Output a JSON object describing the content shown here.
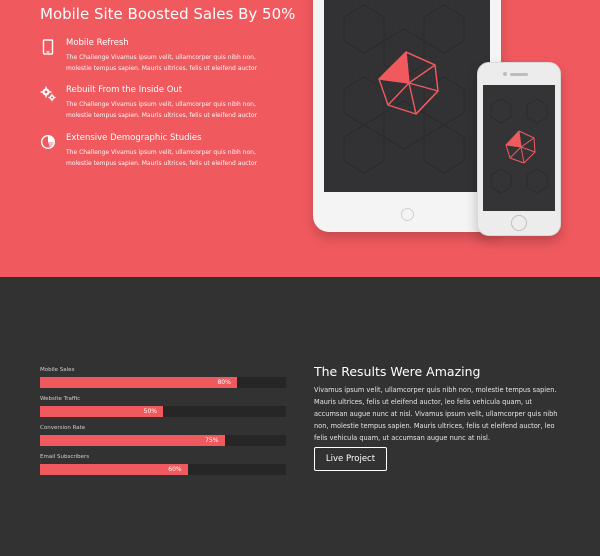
{
  "hero": {
    "title": "Mobile Site Boosted Sales By 50%",
    "features": [
      {
        "icon": "tablet-icon",
        "title": "Mobile Refresh",
        "desc": "The Challenge Vivamus ipsum velit, ullamcorper quis nibh non, molestie tempus sapien. Mauris ultrices, felis ut eleifend auctor"
      },
      {
        "icon": "gears-icon",
        "title": "Rebuilt From the Inside Out",
        "desc": "The Challenge Vivamus ipsum velit, ullamcorper quis nibh non, molestie tempus sapien. Mauris ultrices, felis ut eleifend auctor"
      },
      {
        "icon": "pie-chart-icon",
        "title": "Extensive Demographic Studies",
        "desc": "The Challenge Vivamus ipsum velit, ullamcorper quis nibh non, molestie tempus sapien. Mauris ultrices, felis ut eleifend auctor"
      }
    ],
    "accent_color": "#f05a5f"
  },
  "skills": [
    {
      "label": "Mobile Sales",
      "percent_text": "80%",
      "value": 0.8
    },
    {
      "label": "Website Traffic",
      "percent_text": "50%",
      "value": 0.5
    },
    {
      "label": "Conversion Rate",
      "percent_text": "75%",
      "value": 0.75
    },
    {
      "label": "Email Subscribers",
      "percent_text": "60%",
      "value": 0.6
    }
  ],
  "results": {
    "title": "The Results Were Amazing",
    "body": "Vivamus ipsum velit, ullamcorper quis nibh non, molestie tempus sapien. Mauris ultrices, felis ut eleifend auctor, leo felis vehicula quam, ut accumsan augue nunc at nisl. Vivamus ipsum velit, ullamcorper quis nibh non, molestie tempus sapien. Mauris ultrices, felis ut eleifend auctor, leo felis vehicula quam, ut accumsan augue nunc at nisl.",
    "button_label": "Live Project"
  },
  "colors": {
    "dark_bg": "#323232",
    "bar_track": "#262626"
  }
}
